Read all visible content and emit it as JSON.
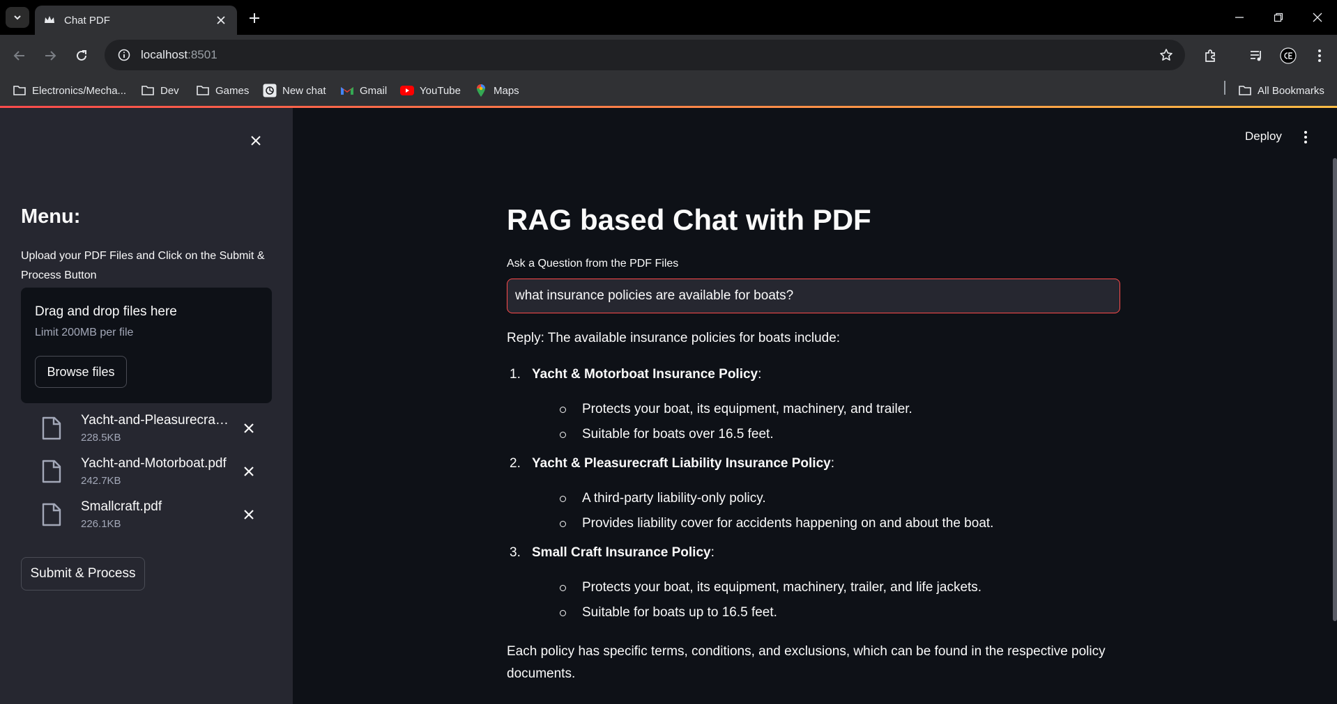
{
  "browser": {
    "tab_title": "Chat PDF",
    "url_host": "localhost",
    "url_port": ":8501",
    "bookmarks": [
      {
        "label": "Electronics/Mecha...",
        "icon": "folder-icon"
      },
      {
        "label": "Dev",
        "icon": "folder-icon"
      },
      {
        "label": "Games",
        "icon": "folder-icon"
      },
      {
        "label": "New chat",
        "icon": "openai-icon"
      },
      {
        "label": "Gmail",
        "icon": "gmail-icon"
      },
      {
        "label": "YouTube",
        "icon": "youtube-icon"
      },
      {
        "label": "Maps",
        "icon": "maps-icon"
      }
    ],
    "all_bookmarks_label": "All Bookmarks"
  },
  "header": {
    "deploy_label": "Deploy"
  },
  "sidebar": {
    "title": "Menu:",
    "description": "Upload your PDF Files and Click on the Submit & Process Button",
    "dropzone_title": "Drag and drop files here",
    "dropzone_limit": "Limit 200MB per file",
    "browse_label": "Browse files",
    "files": [
      {
        "name": "Yacht-and-Pleasurecraft....",
        "size": "228.5KB"
      },
      {
        "name": "Yacht-and-Motorboat.pdf",
        "size": "242.7KB"
      },
      {
        "name": "Smallcraft.pdf",
        "size": "226.1KB"
      }
    ],
    "submit_label": "Submit & Process"
  },
  "main": {
    "title": "RAG based Chat with PDF",
    "question_label": "Ask a Question from the PDF Files",
    "question_value": "what insurance policies are available for boats?",
    "reply_intro": "Reply: The available insurance policies for boats include:",
    "policies": [
      {
        "number": "1.",
        "name": "Yacht & Motorboat Insurance Policy",
        "points": [
          "Protects your boat, its equipment, machinery, and trailer.",
          "Suitable for boats over 16.5 feet."
        ]
      },
      {
        "number": "2.",
        "name": "Yacht & Pleasurecraft Liability Insurance Policy",
        "points": [
          "A third-party liability-only policy.",
          "Provides liability cover for accidents happening on and about the boat."
        ]
      },
      {
        "number": "3.",
        "name": "Small Craft Insurance Policy",
        "points": [
          "Protects your boat, its equipment, machinery, trailer, and life jackets.",
          "Suitable for boats up to 16.5 feet."
        ]
      }
    ],
    "closing": "Each policy has specific terms, conditions, and exclusions, which can be found in the respective policy documents."
  },
  "colors": {
    "app_background": "#0e1117",
    "sidebar_background": "#262730",
    "accent": "#ff4b4b"
  }
}
